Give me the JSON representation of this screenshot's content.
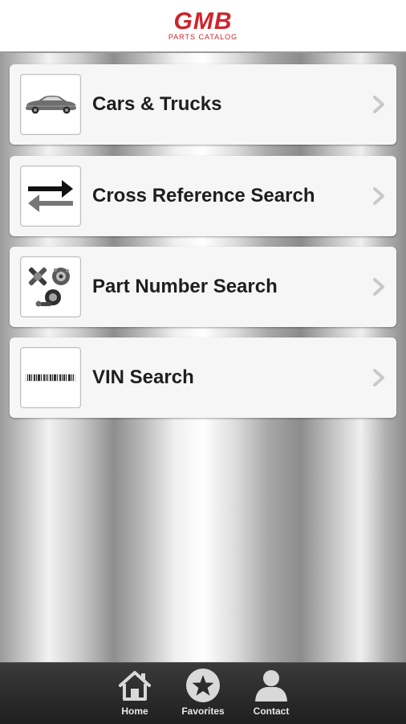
{
  "header": {
    "logo_main": "GMB",
    "logo_sub": "PARTS CATALOG",
    "brand_color": "#d0232a"
  },
  "menu": {
    "items": [
      {
        "label": "Cars & Trucks",
        "icon": "car-icon"
      },
      {
        "label": "Cross Reference Search",
        "icon": "swap-arrows-icon"
      },
      {
        "label": "Part Number Search",
        "icon": "auto-parts-icon"
      },
      {
        "label": "VIN Search",
        "icon": "barcode-icon"
      }
    ]
  },
  "tabbar": {
    "tabs": [
      {
        "label": "Home",
        "icon": "home-icon"
      },
      {
        "label": "Favorites",
        "icon": "star-icon"
      },
      {
        "label": "Contact",
        "icon": "person-icon"
      }
    ]
  }
}
